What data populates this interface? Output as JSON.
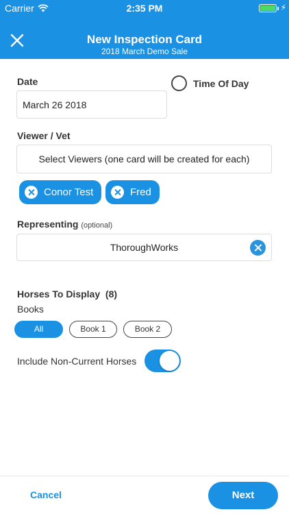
{
  "status_bar": {
    "carrier": "Carrier",
    "time": "2:35 PM",
    "icons": [
      "wifi-icon",
      "battery-icon",
      "charging-bolt-icon"
    ]
  },
  "nav": {
    "title": "New Inspection Card",
    "subtitle": "2018 March Demo Sale",
    "close_icon": "close-icon"
  },
  "date": {
    "label": "Date",
    "value": "March 26 2018"
  },
  "time_of_day": {
    "label": "Time Of Day",
    "selected": false
  },
  "viewer": {
    "label": "Viewer / Vet",
    "select_text": "Select Viewers (one card will be created for each)",
    "chips": [
      {
        "label": "Conor Test"
      },
      {
        "label": "Fred"
      }
    ]
  },
  "representing": {
    "label": "Representing",
    "optional": "(optional)",
    "value": "ThoroughWorks"
  },
  "horses": {
    "label": "Horses To Display",
    "count": "(8)",
    "books_label": "Books",
    "books": [
      {
        "label": "All",
        "active": true
      },
      {
        "label": "Book 1",
        "active": false
      },
      {
        "label": "Book 2",
        "active": false
      }
    ]
  },
  "include_non_current": {
    "label": "Include Non-Current Horses",
    "on": true
  },
  "footer": {
    "cancel": "Cancel",
    "next": "Next"
  },
  "colors": {
    "accent": "#1a91e3",
    "battery": "#4cd964"
  }
}
